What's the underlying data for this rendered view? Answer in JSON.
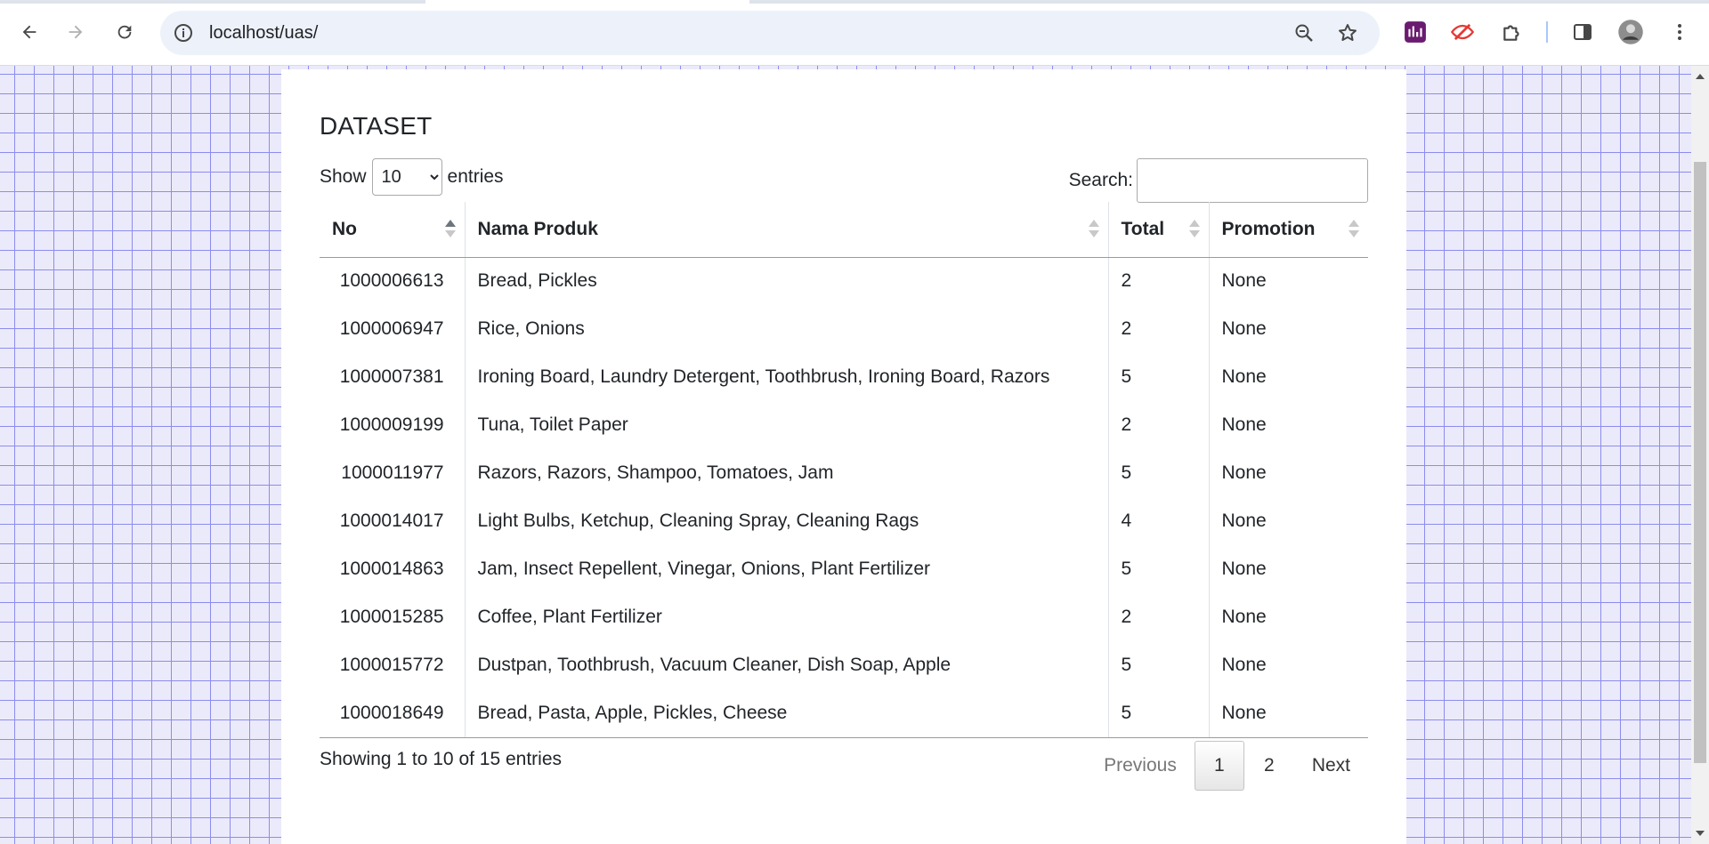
{
  "browser": {
    "url": "localhost/uas/",
    "icons": [
      "back-icon",
      "forward-icon",
      "reload-icon",
      "site-info-icon",
      "zoom-icon",
      "bookmark-star-icon",
      "extension-chart-icon",
      "extension-eye-icon",
      "extensions-puzzle-icon",
      "side-panel-icon",
      "profile-avatar",
      "menu-kebab-icon"
    ]
  },
  "page": {
    "title": "DATASET",
    "length": {
      "show_label": "Show",
      "selected": "10",
      "entries_label": "entries"
    },
    "search": {
      "label": "Search:",
      "value": ""
    },
    "table": {
      "headers": [
        "No",
        "Nama Produk",
        "Total",
        "Promotion"
      ],
      "sorted_column": "No",
      "sort_direction": "ascending",
      "rows": [
        {
          "no": "1000006613",
          "produk": "Bread, Pickles",
          "total": "2",
          "promotion": "None"
        },
        {
          "no": "1000006947",
          "produk": "Rice, Onions",
          "total": "2",
          "promotion": "None"
        },
        {
          "no": "1000007381",
          "produk": "Ironing Board, Laundry Detergent, Toothbrush, Ironing Board, Razors",
          "total": "5",
          "promotion": "None"
        },
        {
          "no": "1000009199",
          "produk": "Tuna, Toilet Paper",
          "total": "2",
          "promotion": "None"
        },
        {
          "no": "1000011977",
          "produk": "Razors, Razors, Shampoo, Tomatoes, Jam",
          "total": "5",
          "promotion": "None"
        },
        {
          "no": "1000014017",
          "produk": "Light Bulbs, Ketchup, Cleaning Spray, Cleaning Rags",
          "total": "4",
          "promotion": "None"
        },
        {
          "no": "1000014863",
          "produk": "Jam, Insect Repellent, Vinegar, Onions, Plant Fertilizer",
          "total": "5",
          "promotion": "None"
        },
        {
          "no": "1000015285",
          "produk": "Coffee, Plant Fertilizer",
          "total": "2",
          "promotion": "None"
        },
        {
          "no": "1000015772",
          "produk": "Dustpan, Toothbrush, Vacuum Cleaner, Dish Soap, Apple",
          "total": "5",
          "promotion": "None"
        },
        {
          "no": "1000018649",
          "produk": "Bread, Pasta, Apple, Pickles, Cheese",
          "total": "5",
          "promotion": "None"
        }
      ]
    },
    "info": "Showing 1 to 10 of 15 entries",
    "pagination": {
      "previous": "Previous",
      "pages": [
        "1",
        "2"
      ],
      "current": "1",
      "next": "Next"
    }
  },
  "colors": {
    "grid_background": "#ebeafa",
    "grid_lines": "#8c8cf0",
    "omnibox": "#edf2fa"
  }
}
